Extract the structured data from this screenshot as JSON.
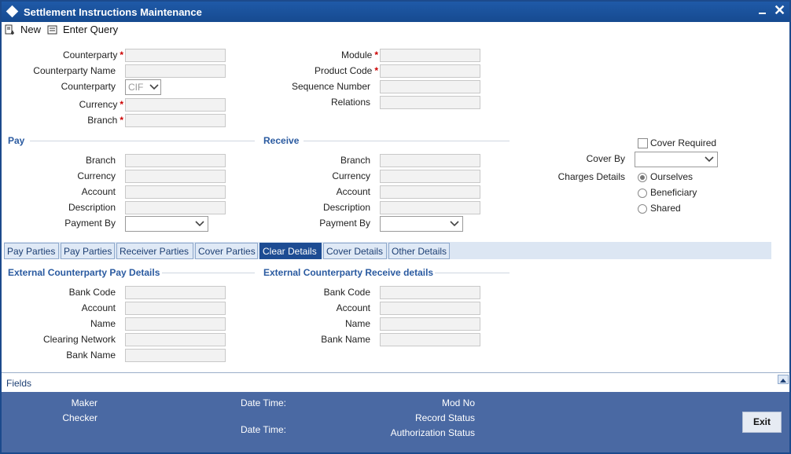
{
  "window": {
    "title": "Settlement Instructions Maintenance"
  },
  "toolbar": {
    "new_label": "New",
    "enter_query_label": "Enter Query"
  },
  "header_left": {
    "counterparty_label": "Counterparty",
    "counterparty_name_label": "Counterparty Name",
    "counterparty_type_label": "Counterparty",
    "counterparty_type_value": "CIF",
    "currency_label": "Currency",
    "branch_label": "Branch",
    "required_mark": "*"
  },
  "header_right": {
    "module_label": "Module",
    "product_code_label": "Product Code",
    "sequence_number_label": "Sequence Number",
    "relations_label": "Relations"
  },
  "pay": {
    "title": "Pay",
    "branch_label": "Branch",
    "currency_label": "Currency",
    "account_label": "Account",
    "description_label": "Description",
    "payment_by_label": "Payment By"
  },
  "receive": {
    "title": "Receive",
    "branch_label": "Branch",
    "currency_label": "Currency",
    "account_label": "Account",
    "description_label": "Description",
    "payment_by_label": "Payment By"
  },
  "cover": {
    "cover_required_label": "Cover Required",
    "cover_by_label": "Cover By",
    "charges_details_label": "Charges Details",
    "options": [
      "Ourselves",
      "Beneficiary",
      "Shared"
    ],
    "selected": "Ourselves"
  },
  "tabs": [
    {
      "label": "Pay Parties"
    },
    {
      "label": "Pay Parties"
    },
    {
      "label": "Receiver Parties"
    },
    {
      "label": "Cover Parties"
    },
    {
      "label": "Clear Details"
    },
    {
      "label": "Cover Details"
    },
    {
      "label": "Other Details"
    }
  ],
  "active_tab": "Clear Details",
  "ext_pay": {
    "title": "External Counterparty Pay Details",
    "bank_code_label": "Bank Code",
    "account_label": "Account",
    "name_label": "Name",
    "clearing_network_label": "Clearing Network",
    "bank_name_label": "Bank Name"
  },
  "ext_receive": {
    "title": "External Counterparty Receive details",
    "bank_code_label": "Bank Code",
    "account_label": "Account",
    "name_label": "Name",
    "bank_name_label": "Bank Name"
  },
  "fields_bar": {
    "label": "Fields"
  },
  "footer": {
    "maker_label": "Maker",
    "checker_label": "Checker",
    "date_time_label_1": "Date Time:",
    "date_time_label_2": "Date Time:",
    "mod_no_label": "Mod No",
    "record_status_label": "Record Status",
    "authorization_status_label": "Authorization Status",
    "exit_label": "Exit"
  },
  "colors": {
    "title_bar": "#1f5aa8",
    "footer": "#4a69a3",
    "active_tab": "#1d4c93",
    "section_title": "#2a5aa0",
    "required": "#cc0000"
  }
}
